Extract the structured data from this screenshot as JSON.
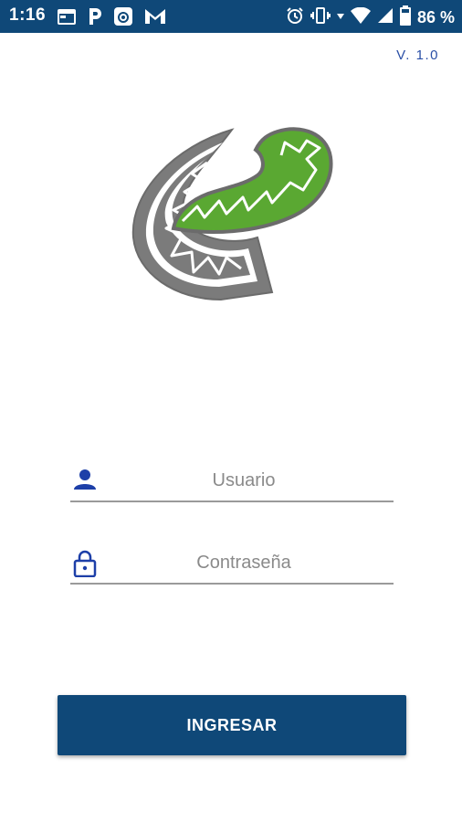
{
  "status_bar": {
    "time": "1:16",
    "battery_text": "86 %",
    "left_icons": [
      "calendar-icon",
      "parking-icon",
      "camera-icon",
      "gmail-icon"
    ],
    "right_icons": [
      "alarm-icon",
      "vibrate-icon",
      "data-arrow-icon",
      "wifi-icon",
      "signal-icon",
      "battery-icon"
    ]
  },
  "version": "V. 1.0",
  "login": {
    "username_placeholder": "Usuario",
    "password_placeholder": "Contraseña",
    "submit_label": "INGRESAR"
  },
  "colors": {
    "primary": "#0f4878",
    "accent_blue": "#2a4fa6",
    "logo_gray": "#7b7b7b",
    "logo_green": "#5aa832"
  }
}
